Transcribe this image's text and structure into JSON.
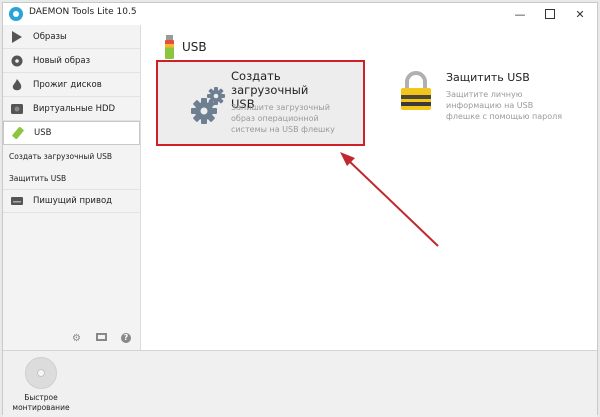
{
  "window": {
    "title": "DAEMON Tools Lite 10.5"
  },
  "sidebar": {
    "items": [
      {
        "label": "Образы",
        "icon": "play-icon"
      },
      {
        "label": "Новый образ",
        "icon": "new-image-icon"
      },
      {
        "label": "Прожиг дисков",
        "icon": "flame-icon"
      },
      {
        "label": "Виртуальные HDD",
        "icon": "hdd-icon"
      },
      {
        "label": "USB",
        "icon": "usb-icon"
      },
      {
        "label": "Пишущий привод",
        "icon": "drive-icon"
      }
    ],
    "usb_subitems": [
      "Создать загрузочный USB",
      "Защитить USB"
    ],
    "tools": [
      "gear-icon",
      "screen-icon",
      "help-icon"
    ]
  },
  "bottom": {
    "quick_mount": {
      "line1": "Быстрое",
      "line2": "монтирование"
    }
  },
  "main": {
    "section_title": "USB",
    "create_usb": {
      "title_line1": "Создать загрузочный",
      "title_line2": "USB",
      "desc_line1": "Запишите загрузочный",
      "desc_line2": "образ операционной",
      "desc_line3": "системы на USB флешку"
    },
    "secure_usb": {
      "title": "Защитить USB",
      "desc_line1": "Защитите личную",
      "desc_line2": "информацию на USB",
      "desc_line3": "флешке с помощью пароля"
    }
  },
  "colors": {
    "highlight": "#d02027",
    "arrow": "#c0282d",
    "accent": "#2aa3d8"
  }
}
